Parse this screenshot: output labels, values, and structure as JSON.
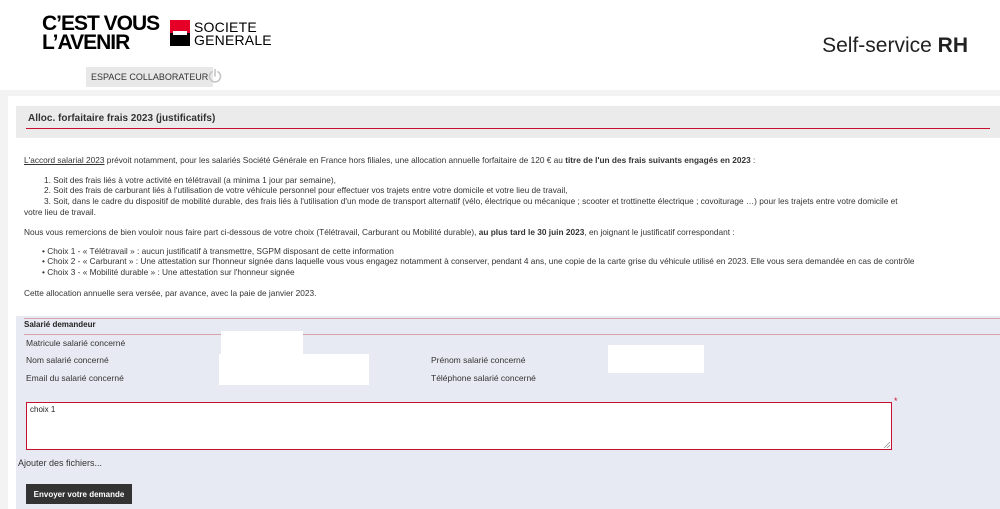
{
  "header": {
    "slogan_line1": "C’EST VOUS",
    "slogan_line2": "L’AVENIR",
    "brand_line1": "SOCIETE",
    "brand_line2": "GENERALE",
    "app_title_prefix": "Self-service",
    "app_title_suffix": "RH",
    "brand_red": "#e60028"
  },
  "nav": {
    "tab_label": "ESPACE COLLABORATEUR",
    "power_icon": "power-icon"
  },
  "page": {
    "title": "Alloc. forfaitaire frais 2023 (justificatifs)"
  },
  "info": {
    "intro_link": "L'accord salarial 2023",
    "intro_text": " prévoit notamment, pour les salariés Société Générale en France hors filiales, une allocation annuelle forfaitaire de 120 € au ",
    "intro_bold": "titre de l'un des frais suivants engagés en 2023",
    "intro_end": " :",
    "items": [
      "1. Soit des frais liés à votre activité en télétravail (a minima 1 jour par semaine),",
      "2. Soit des frais de carburant liés à l'utilisation de votre véhicule personnel pour effectuer vos trajets entre votre domicile et votre lieu de travail,",
      "3. Soit, dans le cadre du dispositif de mobilité durable, des frais liés à l'utilisation d'un mode de transport alternatif (vélo, électrique ou mécanique ; scooter et trottinette électrique ; covoiturage …) pour les trajets entre votre domicile et",
      "votre lieu de travail."
    ],
    "thanks_text": "Nous vous remercions de bien vouloir nous faire part ci-dessous de votre choix (Télétravail, Carburant ou Mobilité durable), ",
    "thanks_bold": "au plus tard le 30 juin 2023",
    "thanks_end": ", en joignant le justificatif correspondant :",
    "choices": [
      "Choix 1 - « Télétravail » : aucun justificatif à transmettre, SGPM disposant de cette information",
      "Choix 2 - « Carburant » : Une attestation sur l'honneur signée dans laquelle vous vous engagez notamment à conserver, pendant 4 ans, une copie de la carte grise du véhicule utilisé en 2023. Elle vous sera demandée en cas de contrôle",
      "Choix 3 - « Mobilité durable » : Une attestation sur l'honneur signée"
    ],
    "closing": "Cette allocation annuelle sera versée, par avance, avec la paie de janvier 2023."
  },
  "form": {
    "section_title": "Salarié demandeur",
    "matricule_label": "Matricule salarié concerné",
    "nom_label": "Nom salarié concerné",
    "prenom_label": "Prénom salarié concerné",
    "email_label": "Email du salarié concerné",
    "telephone_label": "Téléphone salarié concerné",
    "comment_value": "choix 1",
    "required_mark": "*",
    "add_files_label": "Ajouter des fichiers...",
    "submit_label": "Envoyer votre demande"
  }
}
